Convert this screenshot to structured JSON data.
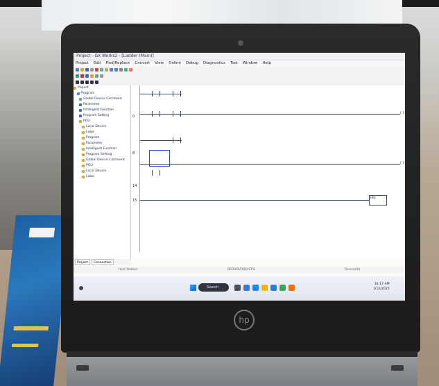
{
  "app": {
    "title": "Project - GX Works2 - [Ladder (Main)]",
    "menu": [
      "Project",
      "Edit",
      "Find/Replace",
      "Convert",
      "View",
      "Online",
      "Debug",
      "Diagnostics",
      "Tool",
      "Window",
      "Help"
    ],
    "tree_items": [
      "Project",
      "Program",
      "Global Device Comment",
      "Parameter",
      "Intelligent Function",
      "Program Setting",
      "POU",
      "Local Device",
      "Label"
    ],
    "tabs": [
      "Project",
      "Connection"
    ],
    "ladder": {
      "rung_numbers": [
        "0",
        "8",
        "14",
        "15"
      ],
      "function_box_label": "END"
    },
    "status": [
      "Host Station",
      "Q03UDV/UDVCPU",
      "Overwrite"
    ],
    "selected_rung": "2"
  },
  "taskbar": {
    "search_placeholder": "Search",
    "time": "10:17 AM",
    "date": "1/12/2025"
  },
  "colors": {
    "screen_bg": "#fbfbf8",
    "selection": "#2d4bd6",
    "taskbar": "#e1e6ee",
    "laptop_body": "#1b1b1c"
  },
  "logo_text": "hp"
}
